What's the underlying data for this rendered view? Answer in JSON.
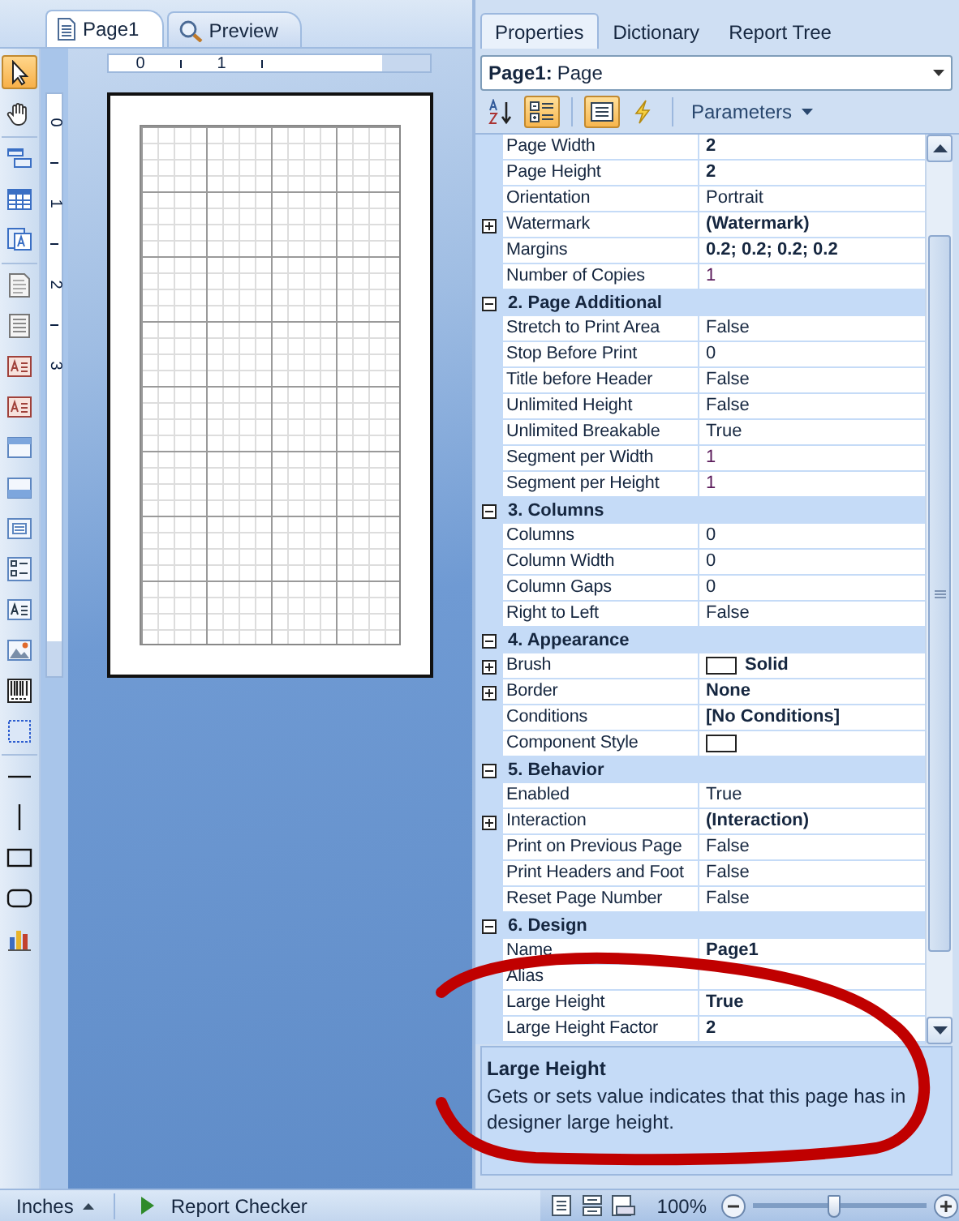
{
  "toolbox": {
    "groups": [
      [
        {
          "kind": "pointer",
          "selected": true
        },
        {
          "kind": "hand",
          "selected": false
        }
      ],
      [
        {
          "kind": "band",
          "selected": false
        },
        {
          "kind": "table-band",
          "selected": false
        },
        {
          "kind": "text-band",
          "selected": false
        }
      ],
      [
        {
          "kind": "page",
          "selected": false
        },
        {
          "kind": "page-lined",
          "selected": false
        },
        {
          "kind": "text-red",
          "selected": false
        },
        {
          "kind": "text-red",
          "selected": false
        },
        {
          "kind": "panel-top",
          "selected": false
        },
        {
          "kind": "panel-bottom",
          "selected": false
        },
        {
          "kind": "form",
          "selected": false
        },
        {
          "kind": "checklist",
          "selected": false
        },
        {
          "kind": "text",
          "selected": false
        },
        {
          "kind": "image",
          "selected": false
        },
        {
          "kind": "barcode",
          "selected": false
        },
        {
          "kind": "container",
          "selected": false
        }
      ],
      [
        {
          "kind": "hline",
          "selected": false
        },
        {
          "kind": "vline",
          "selected": false
        },
        {
          "kind": "rectangle",
          "selected": false
        },
        {
          "kind": "rounded",
          "selected": false
        },
        {
          "kind": "chart",
          "selected": false
        }
      ]
    ]
  },
  "document_tabs": [
    {
      "label": "Page1",
      "kind": "page",
      "selected": true
    },
    {
      "label": "Preview",
      "kind": "preview",
      "selected": false
    }
  ],
  "horizontal_ruler": [
    "0",
    "1"
  ],
  "vertical_ruler": [
    "0",
    "1",
    "2",
    "3"
  ],
  "properties_panel": {
    "tabs": [
      {
        "label": "Properties",
        "selected": true
      },
      {
        "label": "Dictionary",
        "selected": false
      },
      {
        "label": "Report Tree",
        "selected": false
      }
    ],
    "object_selector": {
      "name": "Page1:",
      "type": "Page"
    },
    "toolbar": {
      "buttons": [
        {
          "kind": "sort",
          "selected": false
        },
        {
          "kind": "categorized",
          "selected": true
        },
        {
          "kind": "property-pages",
          "selected": true
        },
        {
          "kind": "events",
          "selected": false
        }
      ],
      "menu": "Parameters"
    },
    "rows": [
      {
        "kind": "property",
        "name": "Page Width",
        "value": "2",
        "bold": true,
        "numeric": false
      },
      {
        "kind": "property",
        "name": "Page Height",
        "value": "2",
        "bold": true,
        "numeric": false
      },
      {
        "kind": "property",
        "name": "Orientation",
        "value": "Portrait",
        "bold": false,
        "numeric": false
      },
      {
        "kind": "expandable",
        "name": "Watermark",
        "value": "(Watermark)",
        "bold": true,
        "numeric": false
      },
      {
        "kind": "property",
        "name": "Margins",
        "value": "0.2; 0.2; 0.2; 0.2",
        "bold": true,
        "numeric": false
      },
      {
        "kind": "property",
        "name": "Number of Copies",
        "value": "1",
        "bold": false,
        "numeric": true
      },
      {
        "kind": "category",
        "name": "2. Page Additional",
        "expanded": true
      },
      {
        "kind": "property",
        "name": "Stretch to Print Area",
        "value": "False",
        "bold": false,
        "numeric": false
      },
      {
        "kind": "property",
        "name": "Stop Before Print",
        "value": "0",
        "bold": false,
        "numeric": false
      },
      {
        "kind": "property",
        "name": "Title before Header",
        "value": "False",
        "bold": false,
        "numeric": false
      },
      {
        "kind": "property",
        "name": "Unlimited Height",
        "value": "False",
        "bold": false,
        "numeric": false
      },
      {
        "kind": "property",
        "name": "Unlimited Breakable",
        "value": "True",
        "bold": false,
        "numeric": false
      },
      {
        "kind": "property",
        "name": "Segment per Width",
        "value": "1",
        "bold": false,
        "numeric": true
      },
      {
        "kind": "property",
        "name": "Segment per Height",
        "value": "1",
        "bold": false,
        "numeric": true
      },
      {
        "kind": "category",
        "name": "3. Columns",
        "expanded": true
      },
      {
        "kind": "property",
        "name": "Columns",
        "value": "0",
        "bold": false,
        "numeric": false
      },
      {
        "kind": "property",
        "name": "Column Width",
        "value": "0",
        "bold": false,
        "numeric": false
      },
      {
        "kind": "property",
        "name": "Column Gaps",
        "value": "0",
        "bold": false,
        "numeric": false
      },
      {
        "kind": "property",
        "name": "Right to Left",
        "value": "False",
        "bold": false,
        "numeric": false
      },
      {
        "kind": "category",
        "name": "4. Appearance",
        "expanded": true
      },
      {
        "kind": "expandable",
        "name": "Brush",
        "value": "Solid",
        "bold": true,
        "numeric": false,
        "swatch": true
      },
      {
        "kind": "expandable",
        "name": "Border",
        "value": "None",
        "bold": true,
        "numeric": false
      },
      {
        "kind": "property",
        "name": "Conditions",
        "value": "[No Conditions]",
        "bold": true,
        "numeric": false
      },
      {
        "kind": "property",
        "name": "Component Style",
        "swatch": true
      },
      {
        "kind": "category",
        "name": "5. Behavior",
        "expanded": true
      },
      {
        "kind": "property",
        "name": "Enabled",
        "value": "True",
        "bold": false,
        "numeric": false
      },
      {
        "kind": "expandable",
        "name": "Interaction",
        "value": "(Interaction)",
        "bold": true,
        "numeric": false
      },
      {
        "kind": "property",
        "name": "Print on Previous Page",
        "value": "False",
        "bold": false,
        "numeric": false
      },
      {
        "kind": "property",
        "name": "Print Headers and Foot",
        "value": "False",
        "bold": false,
        "numeric": false
      },
      {
        "kind": "property",
        "name": "Reset Page Number",
        "value": "False",
        "bold": false,
        "numeric": false
      },
      {
        "kind": "category",
        "name": "6. Design",
        "expanded": true
      },
      {
        "kind": "property",
        "name": "Name",
        "value": "Page1",
        "bold": true,
        "numeric": false
      },
      {
        "kind": "property",
        "name": "Alias"
      },
      {
        "kind": "property",
        "name": "Large Height",
        "value": "True",
        "bold": true,
        "numeric": false
      },
      {
        "kind": "property",
        "name": "Large Height Factor",
        "value": "2",
        "bold": true,
        "numeric": false
      }
    ],
    "description": {
      "title": "Large Height",
      "text": "Gets or sets value indicates that this page has in designer large height."
    }
  },
  "status_bar": {
    "units": "Inches",
    "checker": "Report Checker",
    "view_buttons": [
      {
        "kind": "page"
      },
      {
        "kind": "continuous"
      },
      {
        "kind": "multi"
      }
    ],
    "zoom": "100%",
    "zoom_slider": {
      "level": 0.47
    }
  },
  "annotation": {
    "kind": "marker-loop"
  }
}
